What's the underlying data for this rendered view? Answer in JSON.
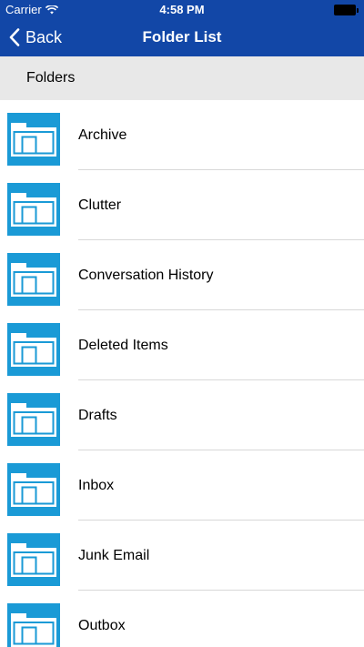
{
  "status_bar": {
    "carrier": "Carrier",
    "time": "4:58 PM"
  },
  "nav_bar": {
    "back_label": "Back",
    "title": "Folder List",
    "background_color": "#1247a7"
  },
  "section": {
    "header": "Folders"
  },
  "folders": [
    {
      "label": "Archive",
      "icon": "folder-icon"
    },
    {
      "label": "Clutter",
      "icon": "folder-icon"
    },
    {
      "label": "Conversation History",
      "icon": "folder-icon"
    },
    {
      "label": "Deleted Items",
      "icon": "folder-icon"
    },
    {
      "label": "Drafts",
      "icon": "folder-icon"
    },
    {
      "label": "Inbox",
      "icon": "folder-icon"
    },
    {
      "label": "Junk Email",
      "icon": "folder-icon"
    },
    {
      "label": "Outbox",
      "icon": "folder-icon"
    }
  ],
  "colors": {
    "folder_tile": "#1a9ad6",
    "section_header_bg": "#e8e8e8"
  }
}
